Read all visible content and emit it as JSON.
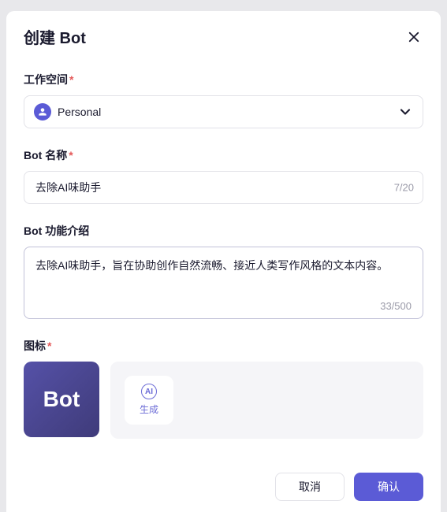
{
  "dialog": {
    "title": "创建 Bot"
  },
  "workspace": {
    "label": "工作空间",
    "required": "*",
    "selected": "Personal"
  },
  "bot_name": {
    "label": "Bot 名称",
    "required": "*",
    "value": "去除AI味助手",
    "counter": "7/20"
  },
  "bot_desc": {
    "label": "Bot 功能介绍",
    "value": "去除AI味助手，旨在协助创作自然流畅、接近人类写作风格的文本内容。",
    "counter": "33/500"
  },
  "icon_section": {
    "label": "图标",
    "required": "*",
    "preview_text": "Bot",
    "generate_icon_text": "AI",
    "generate_label": "生成"
  },
  "footer": {
    "cancel": "取消",
    "confirm": "确认"
  }
}
